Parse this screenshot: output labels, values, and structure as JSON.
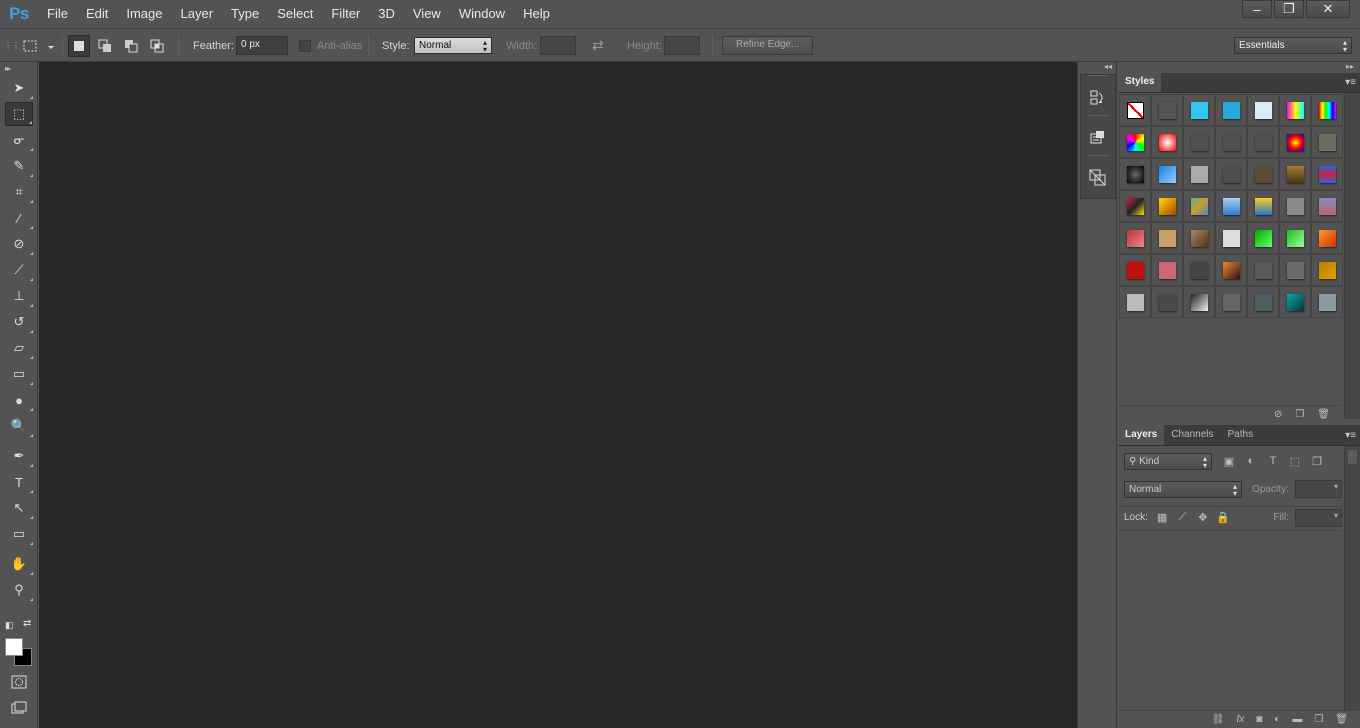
{
  "app": {
    "logo": "Ps"
  },
  "menu": [
    "File",
    "Edit",
    "Image",
    "Layer",
    "Type",
    "Select",
    "Filter",
    "3D",
    "View",
    "Window",
    "Help"
  ],
  "window_controls": {
    "minimize": "–",
    "restore": "❐",
    "close": "✕"
  },
  "options_bar": {
    "feather_label": "Feather:",
    "feather_value": "0 px",
    "antialias_label": "Anti-alias",
    "style_label": "Style:",
    "style_value": "Normal",
    "width_label": "Width:",
    "height_label": "Height:",
    "refine_edge": "Refine Edge...",
    "workspace": "Essentials"
  },
  "tools": [
    {
      "name": "move-tool-icon",
      "glyph": "➤"
    },
    {
      "name": "rectangular-marquee-tool-icon",
      "glyph": "⬚",
      "active": true
    },
    {
      "name": "lasso-tool-icon",
      "glyph": "ᓂ"
    },
    {
      "name": "quick-selection-tool-icon",
      "glyph": "✎"
    },
    {
      "name": "crop-tool-icon",
      "glyph": "⌗"
    },
    {
      "name": "eyedropper-tool-icon",
      "glyph": "⁄"
    },
    {
      "name": "spot-healing-brush-icon",
      "glyph": "⊘"
    },
    {
      "name": "brush-tool-icon",
      "glyph": "⟋"
    },
    {
      "name": "clone-stamp-tool-icon",
      "glyph": "⊥"
    },
    {
      "name": "history-brush-tool-icon",
      "glyph": "↺"
    },
    {
      "name": "eraser-tool-icon",
      "glyph": "▱"
    },
    {
      "name": "gradient-tool-icon",
      "glyph": "▭"
    },
    {
      "name": "blur-tool-icon",
      "glyph": "●"
    },
    {
      "name": "dodge-tool-icon",
      "glyph": "🔍"
    },
    {
      "name": "pen-tool-icon",
      "glyph": "✒"
    },
    {
      "name": "type-tool-icon",
      "glyph": "T"
    },
    {
      "name": "path-selection-tool-icon",
      "glyph": "↖"
    },
    {
      "name": "rectangle-tool-icon",
      "glyph": "▭"
    },
    {
      "name": "hand-tool-icon",
      "glyph": "✋"
    },
    {
      "name": "zoom-tool-icon",
      "glyph": "⚲"
    }
  ],
  "colors": {
    "foreground": "#ffffff",
    "background": "#000000",
    "canvas": "#282828",
    "accent": "#3fa0e6"
  },
  "styles_panel": {
    "tab": "Styles"
  },
  "styles_swatches": [
    "none",
    "#555555",
    "#33c6ef",
    "#2aa7d9",
    "#d8eef7",
    "linear-gradient(90deg,#f0e,#ff0,#0ff)",
    "linear-gradient(90deg,#f00,#ff0,#0f0,#0ff,#00f,#f0f)",
    "conic-gradient(#f00,#ff0,#0f0,#0ff,#00f,#f0f,#f00)",
    "radial-gradient(#fff,#e00)",
    "#505050",
    "#505050",
    "#505050",
    "radial-gradient(#ff0,#f00,#00c)",
    "#6c6c60",
    "radial-gradient(#666,#000)",
    "linear-gradient(135deg,#1a7fe0,#9cf)",
    "#aaaaaa",
    "#4e4e4e",
    "#5c4c30",
    "linear-gradient(#a67c36,#4a3512)",
    "linear-gradient(#26d,#c24,#26d)",
    "linear-gradient(135deg,#c24,#222,#fd0)",
    "linear-gradient(135deg,#fd0,#a40)",
    "linear-gradient(135deg,#5b7,#c93,#48c)",
    "linear-gradient(#a6d2f7,#2f7dd0)",
    "linear-gradient(#fc2,#2477c7)",
    "#8a8a8a",
    "linear-gradient(#88b,#b67)",
    "linear-gradient(135deg,#b33,#e88)",
    "#c9a06a",
    "linear-gradient(135deg,#a86,#531)",
    "#dddddd",
    "linear-gradient(135deg,#0a0,#6f6)",
    "linear-gradient(135deg,#2b2,#9f9)",
    "linear-gradient(135deg,#f93,#c30)",
    "#c01010",
    "#cc6677",
    "#454545",
    "linear-gradient(135deg,#e83,#311)",
    "#5a5a5a",
    "#6a6a6a",
    "linear-gradient(135deg,#a80,#e90)",
    "#bbbbbb",
    "#4a4a4a",
    "linear-gradient(135deg,#222,#eee)",
    "#666666",
    "#4e5e62",
    "linear-gradient(135deg,#0aa,#133)",
    "#8a9aa0"
  ],
  "layers_panel": {
    "tabs": [
      "Layers",
      "Channels",
      "Paths"
    ],
    "kind_label": "Kind",
    "blend_mode": "Normal",
    "opacity_label": "Opacity:",
    "lock_label": "Lock:",
    "fill_label": "Fill:"
  }
}
